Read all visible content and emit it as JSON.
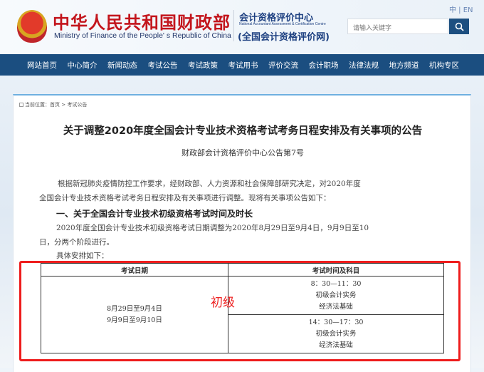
{
  "header": {
    "cn_title": "中华人民共和国财政部",
    "en_title": "Ministry of Finance of the People' s Republic of China",
    "center_cn": "会计资格评价中心",
    "center_en": "National Accountant Assessment & Certification Centre",
    "center_net": "(全国会计资格评价网)",
    "lang": "中 | EN",
    "search_placeholder": "请输入关键字"
  },
  "nav": [
    "网站首页",
    "中心简介",
    "新闻动态",
    "考试公告",
    "考试政策",
    "考试用书",
    "评价交流",
    "会计职场",
    "法律法规",
    "地方频道",
    "机构专区"
  ],
  "breadcrumb": "当前位置：首页 > 考试公告",
  "article": {
    "title": "关于调整2020年度全国会计专业技术资格考试考务日程安排及有关事项的公告",
    "number": "财政部会计资格评价中心公告第7号",
    "p1a": "根据新冠肺炎疫情防控工作要求，经财政部、人力资源和社会保障部研究决定，对2020年度",
    "p1b": "全国会计专业技术资格考试考务日程安排及有关事项进行调整。现将有关事项公告如下：",
    "h1": "一、关于全国会计专业技术初级资格考试时间及时长",
    "p2a": "2020年度全国会计专业技术初级资格考试日期调整为2020年8月29日至9月4日，9月9日至10",
    "p2b": "日，分两个阶段进行。",
    "p3": "具体安排如下："
  },
  "table": {
    "headers": [
      "考试日期",
      "考试时间及科目"
    ],
    "dates": [
      "8月29日至9月4日",
      "9月9日至9月10日"
    ],
    "sessions": [
      {
        "time": "8：30—11：30",
        "subjects": [
          "初级会计实务",
          "经济法基础"
        ]
      },
      {
        "time": "14：30—17：30",
        "subjects": [
          "初级会计实务",
          "经济法基础"
        ]
      }
    ]
  },
  "annotation": "初级"
}
